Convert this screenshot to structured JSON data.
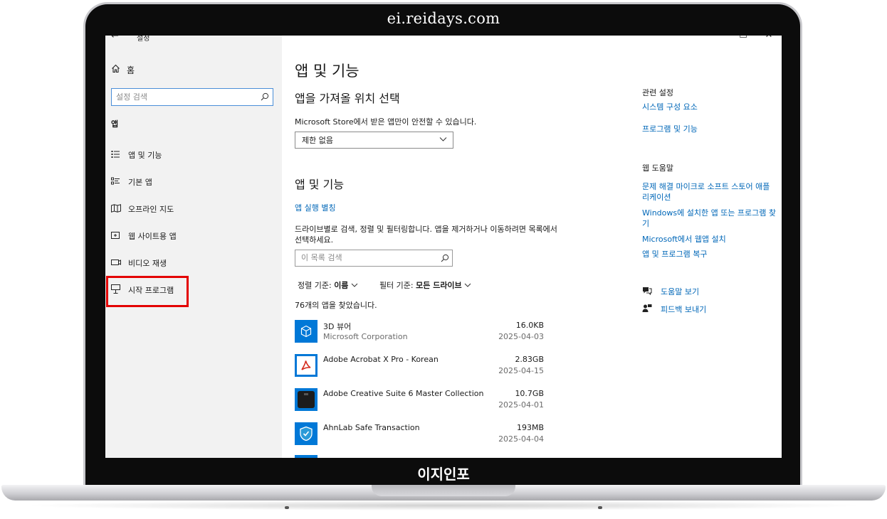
{
  "watermark": {
    "top": "ei.reidays.com",
    "bottom": "이지인포"
  },
  "window": {
    "back_icon": "←",
    "title": "설정",
    "controls": [
      "—",
      "☐",
      "✕"
    ]
  },
  "sidebar": {
    "home_label": "홈",
    "search_placeholder": "설정 검색",
    "section": "앱",
    "items": [
      {
        "label": "앱 및 기능",
        "icon": "apps-features-icon"
      },
      {
        "label": "기본 앱",
        "icon": "default-apps-icon"
      },
      {
        "label": "오프라인 지도",
        "icon": "offline-maps-icon"
      },
      {
        "label": "웹 사이트용 앱",
        "icon": "apps-for-websites-icon"
      },
      {
        "label": "비디오 재생",
        "icon": "video-playback-icon"
      },
      {
        "label": "시작 프로그램",
        "icon": "startup-icon"
      }
    ],
    "highlight_color": "#e30000"
  },
  "main": {
    "page_title": "앱 및 기능",
    "source_title": "앱을 가져올 위치 선택",
    "source_desc": "Microsoft Store에서 받은 앱만이 안전할 수 있습니다.",
    "source_dropdown": "제한 없음",
    "list_title": "앱 및 기능",
    "alias_link": "앱 실행 별칭",
    "list_desc": "드라이브별로 검색, 정렬 및 필터링합니다. 앱을 제거하거나 이동하려면 목록에서 선택하세요.",
    "list_search_placeholder": "이 목록 검색",
    "sort_label": "정렬 기준:",
    "sort_value": "이름",
    "filter_label": "필터 기준:",
    "filter_value": "모든 드라이브",
    "found_text": "76개의 앱을 찾았습니다.",
    "apps": [
      {
        "name": "3D 뷰어",
        "publisher": "Microsoft Corporation",
        "size": "16.0KB",
        "date": "2025-04-03",
        "icon": "3d-viewer-icon"
      },
      {
        "name": "Adobe Acrobat X Pro - Korean",
        "publisher": "",
        "size": "2.83GB",
        "date": "2025-04-15",
        "icon": "acrobat-icon"
      },
      {
        "name": "Adobe Creative Suite 6 Master Collection",
        "publisher": "",
        "size": "10.7GB",
        "date": "2025-04-01",
        "icon": "creative-suite-icon"
      },
      {
        "name": "AhnLab Safe Transaction",
        "publisher": "",
        "size": "193MB",
        "date": "2025-04-04",
        "icon": "ahnlab-icon"
      }
    ]
  },
  "right": {
    "related_heading": "관련 설정",
    "related_links": [
      "시스템 구성 요소",
      "프로그램 및 기능"
    ],
    "help_heading": "웹 도움말",
    "help_links": [
      "문제 해결 마이크로 소프트 스토어 애플 리케이션",
      "Windows에 설치한 앱 또는 프로그램 찾기",
      "Microsoft에서 웹앱 설치",
      "앱 및 프로그램 복구"
    ],
    "get_help": "도움말 보기",
    "feedback": "피드백 보내기"
  },
  "colors": {
    "accent": "#0067b8",
    "sidebar_bg": "#f2f2f2",
    "tile_blue": "#0078d7"
  }
}
